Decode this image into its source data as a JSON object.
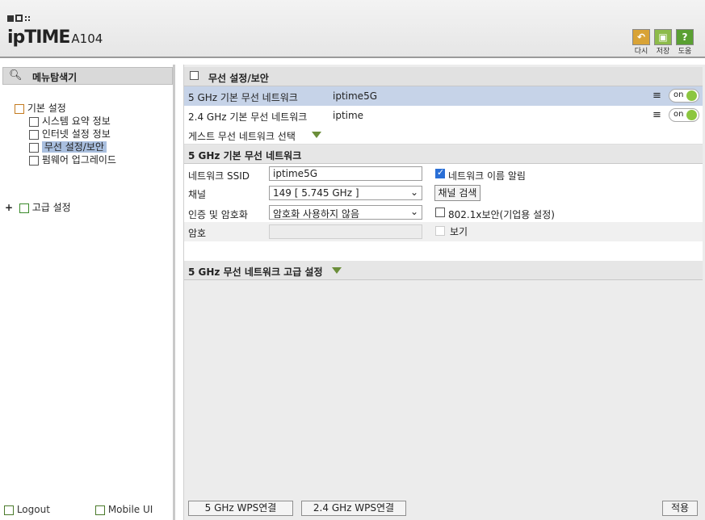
{
  "header": {
    "logo_text": "ipTIME",
    "model": "A104",
    "buttons": [
      {
        "label": "다시",
        "icon": "undo-icon",
        "color": "#d9a336"
      },
      {
        "label": "저장",
        "icon": "save-icon",
        "color": "#8dbb4a"
      },
      {
        "label": "도움",
        "icon": "help-icon",
        "color": "#5aa032"
      }
    ]
  },
  "sidebar": {
    "title": "메뉴탐색기",
    "groups": [
      {
        "label": "기본 설정",
        "items": [
          "시스템 요약 정보",
          "인터넷 설정 정보",
          "무선 설정/보안",
          "펌웨어 업그레이드"
        ],
        "selected": "무선 설정/보안"
      },
      {
        "label": "고급 설정",
        "expander": "+"
      }
    ],
    "footer": {
      "logout": "Logout",
      "mobile": "Mobile UI"
    }
  },
  "main": {
    "title": "무선 설정/보안",
    "networks": [
      {
        "label": "5 GHz 기본 무선 네트워크",
        "ssid": "iptime5G",
        "toggle": "on"
      },
      {
        "label": "2.4 GHz 기본 무선 네트워크",
        "ssid": "iptime",
        "toggle": "on"
      }
    ],
    "guest_label": "게스트 무선 네트워크 선택",
    "basic_section": {
      "title": "5 GHz 기본 무선 네트워크",
      "ssid_label": "네트워크 SSID",
      "ssid_value": "iptime5G",
      "broadcast_label": "네트워크 이름 알림",
      "broadcast_checked": true,
      "channel_label": "채널",
      "channel_value": "149 [ 5.745 GHz ]",
      "channel_search": "채널 검색",
      "auth_label": "인증 및 암호화",
      "auth_value": "암호화 사용하지 않음",
      "enterprise_label": "802.1x보안(기업용 설정)",
      "password_label": "암호",
      "password_value": "",
      "show_label": "보기"
    },
    "advanced_title": "5 GHz 무선 네트워크 고급 설정",
    "footer_buttons": {
      "wps5": "5 GHz WPS연결",
      "wps24": "2.4 GHz WPS연결",
      "apply": "적용"
    }
  }
}
